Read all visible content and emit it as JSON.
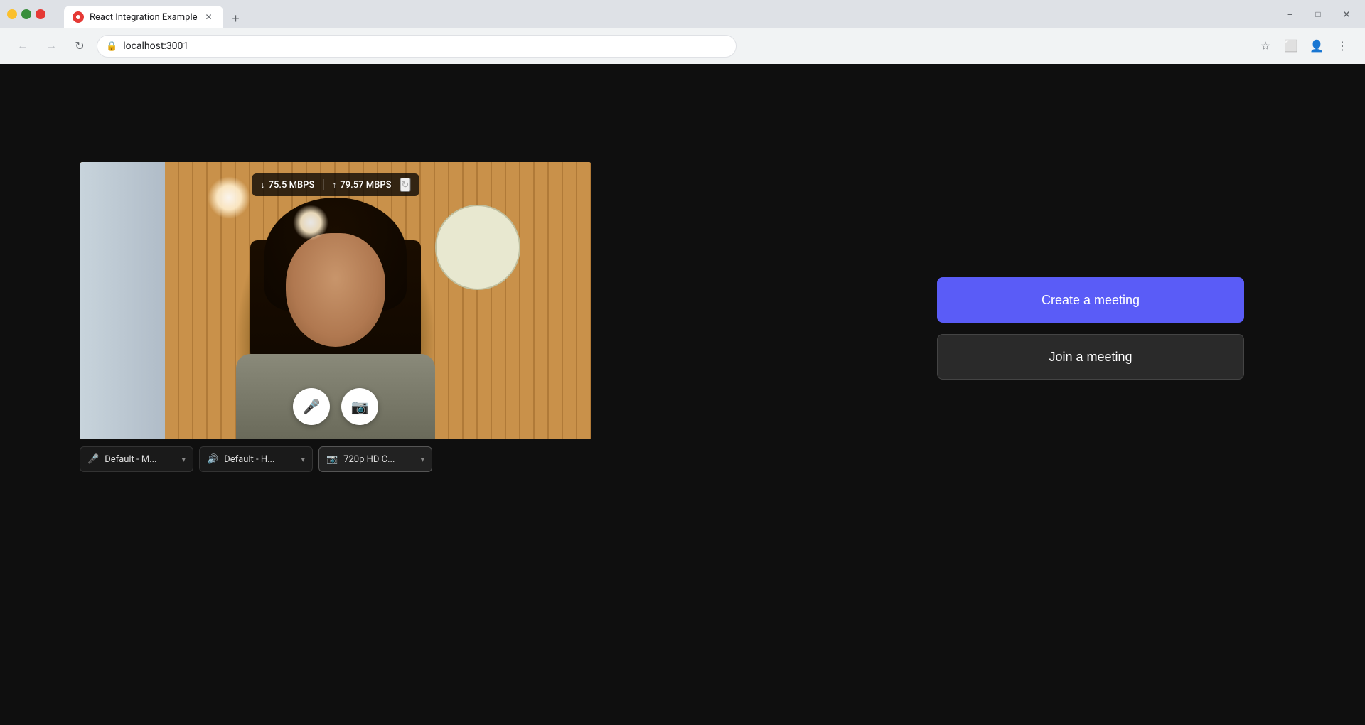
{
  "browser": {
    "tab": {
      "title": "React Integration Example",
      "favicon_color": "#e53935"
    },
    "address": "localhost:3001",
    "window_controls": {
      "minimize_label": "−",
      "maximize_label": "□",
      "close_label": "✕"
    }
  },
  "video": {
    "network_stats": {
      "download_speed": "75.5 MBPS",
      "upload_speed": "79.57 MBPS",
      "download_arrow": "↓",
      "upload_arrow": "↑"
    },
    "controls": {
      "mic_label": "🎤",
      "camera_label": "📷"
    },
    "devices": {
      "microphone_label": "Default - M...",
      "microphone_icon": "🎤",
      "speaker_label": "Default - H...",
      "speaker_icon": "🔊",
      "camera_label": "720p HD C...",
      "camera_icon": "📷"
    }
  },
  "actions": {
    "create_meeting_label": "Create a meeting",
    "join_meeting_label": "Join a meeting"
  },
  "icons": {
    "back": "←",
    "forward": "→",
    "refresh": "↻",
    "lock": "🔒",
    "bookmark": "☆",
    "extensions": "⬜",
    "profile": "👤",
    "more": "⋮",
    "chevron_down": "▾"
  }
}
